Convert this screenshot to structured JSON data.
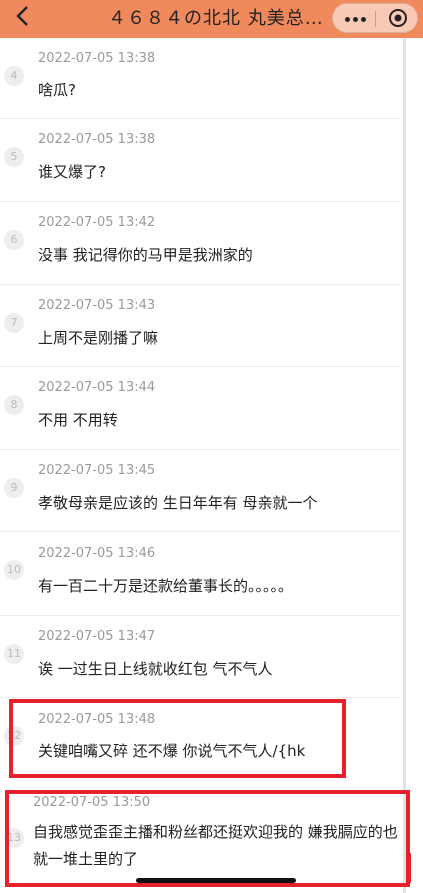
{
  "header": {
    "title": "４６８４の北北 丸美总…"
  },
  "messages": [
    {
      "index": "4",
      "time": "2022-07-05 13:38",
      "text": "啥瓜?"
    },
    {
      "index": "5",
      "time": "2022-07-05 13:38",
      "text": "谁又爆了?"
    },
    {
      "index": "6",
      "time": "2022-07-05 13:42",
      "text": "没事 我记得你的马甲是我洲家的"
    },
    {
      "index": "7",
      "time": "2022-07-05 13:43",
      "text": "上周不是刚播了嘛"
    },
    {
      "index": "8",
      "time": "2022-07-05 13:44",
      "text": "不用 不用转"
    },
    {
      "index": "9",
      "time": "2022-07-05 13:45",
      "text": "孝敬母亲是应该的 生日年年有 母亲就一个"
    },
    {
      "index": "10",
      "time": "2022-07-05 13:46",
      "text": "有一百二十万是还款给董事长的。。。。。"
    },
    {
      "index": "11",
      "time": "2022-07-05 13:47",
      "text": "诶 一过生日上线就收红包 气不气人"
    },
    {
      "index": "12",
      "time": "2022-07-05 13:48",
      "text": "关键咱嘴又碎 还不爆 你说气不气人/{hk"
    },
    {
      "index": "13",
      "time": "2022-07-05 13:50",
      "text": "自我感觉歪歪主播和粉丝都还挺欢迎我的 嫌我膈应的也就一堆土里的了"
    }
  ],
  "colors": {
    "header_bg": "#f08a5d",
    "highlight_border": "#e8202a",
    "timestamp": "#9a9a9a"
  }
}
